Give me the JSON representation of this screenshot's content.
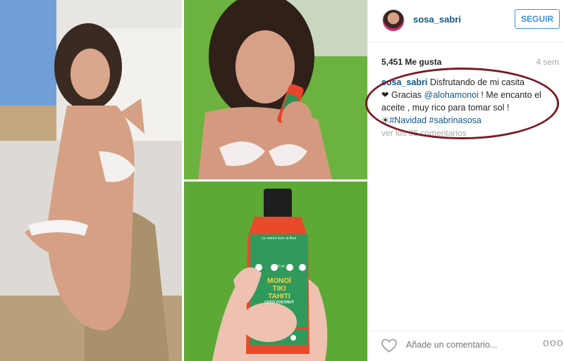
{
  "profile": {
    "username": "sosa_sabri",
    "follow_label": "SEGUIR"
  },
  "post": {
    "likes": "5,451 Me gusta",
    "time": "4 sem",
    "caption": {
      "author": "sosa_sabri",
      "text_1": "Disfrutando de mi casita",
      "heart_glyph": "❤",
      "text_2": "Gracias",
      "mention": "@alohamonoi",
      "text_3": "! Me encanto el aceite , muy rico para tomar sol !",
      "sun_glyph": "☀",
      "hashtag_1": "#Navidad",
      "hashtag_2": "#sabrinasosa"
    },
    "view_comments": "ver los 36 comentarios",
    "add_comment_placeholder": "Añade un comentario...",
    "more_label": "ooo"
  },
  "product_label": {
    "brand_line_1": "MONOÏ",
    "brand_line_2": "TIKI",
    "brand_line_3": "TAHITI",
    "variant": "COCO COCONUT",
    "volume": "120 ml",
    "tagline": "Le monoï avec la fleur"
  },
  "colors": {
    "link": "#125688",
    "follow_accent": "#4090db",
    "annotation_ring": "#7a1a24",
    "muted": "#a5a7aa"
  }
}
